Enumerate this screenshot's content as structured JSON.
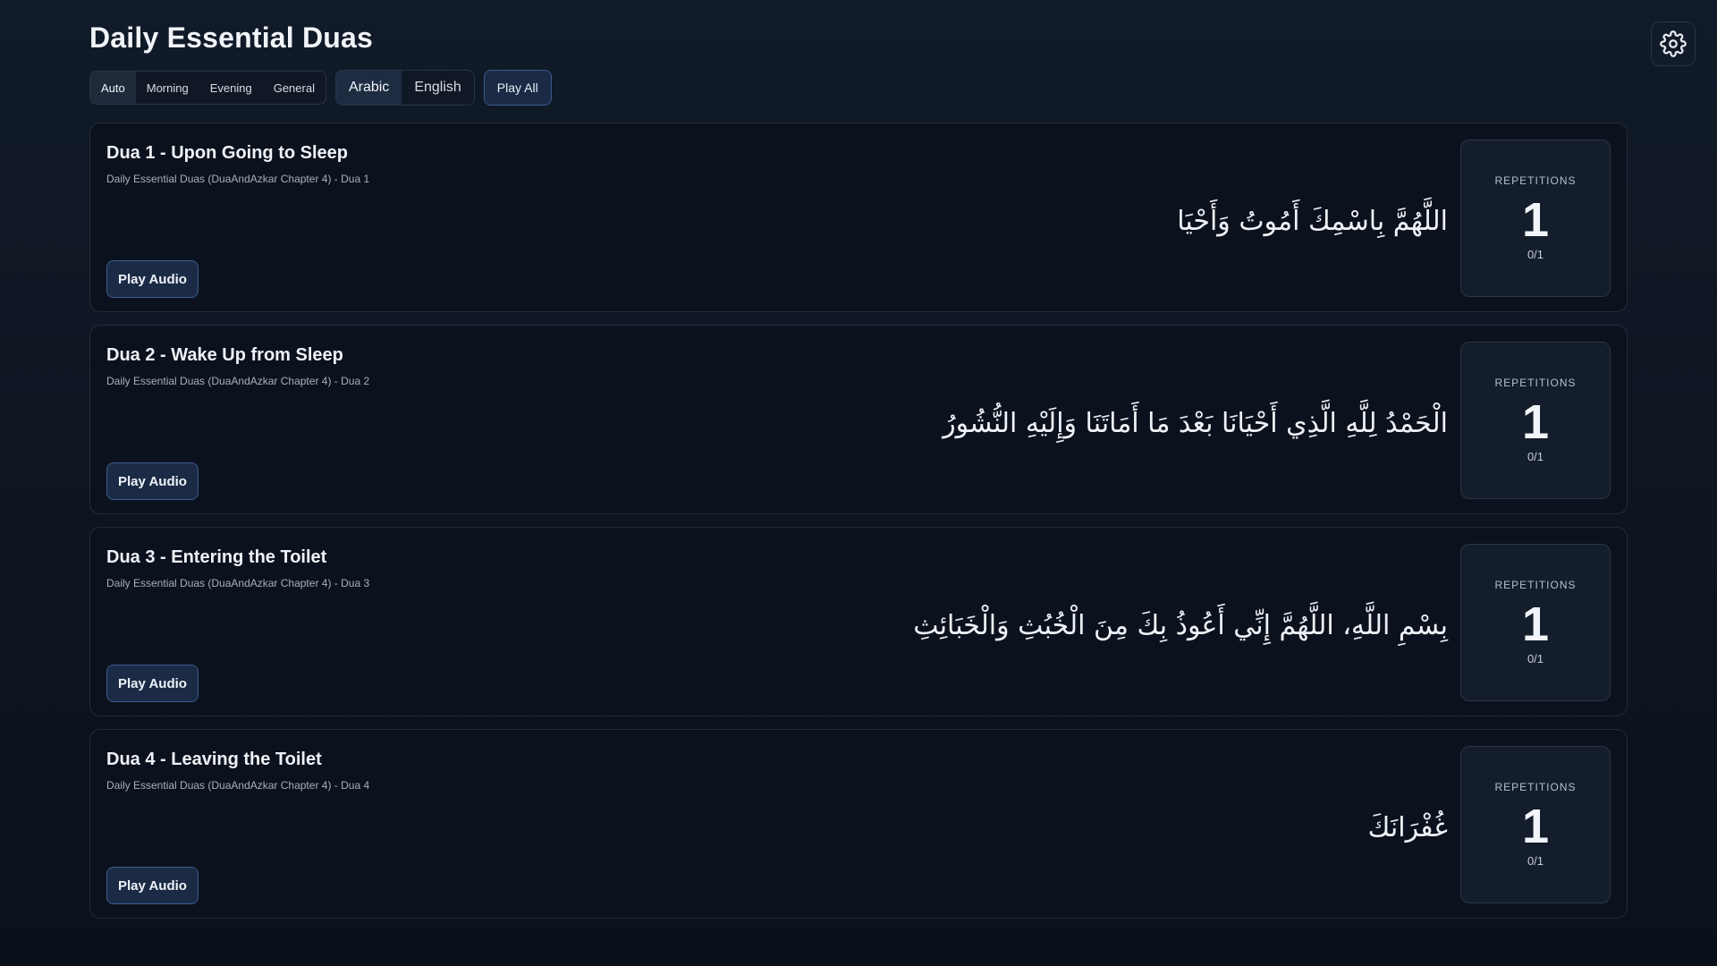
{
  "header": {
    "title": "Daily Essential Duas",
    "settings_icon": "gear-icon"
  },
  "controls": {
    "time_filters": [
      {
        "label": "Auto",
        "active": true
      },
      {
        "label": "Morning",
        "active": false
      },
      {
        "label": "Evening",
        "active": false
      },
      {
        "label": "General",
        "active": false
      }
    ],
    "languages": [
      {
        "label": "Arabic",
        "active": true
      },
      {
        "label": "English",
        "active": false
      }
    ],
    "play_all_label": "Play All"
  },
  "duas": [
    {
      "title": "Dua 1 - Upon Going to Sleep",
      "source": "Daily Essential Duas (DuaAndAzkar Chapter 4) - Dua 1",
      "arabic": "اللَّهُمَّ بِاسْمِكَ أَمُوتُ وَأَحْيَا",
      "play_label": "Play Audio",
      "repetitions_label": "REPETITIONS",
      "repetitions": "1",
      "progress": "0/1"
    },
    {
      "title": "Dua 2 - Wake Up from Sleep",
      "source": "Daily Essential Duas (DuaAndAzkar Chapter 4) - Dua 2",
      "arabic": "الْحَمْدُ لِلَّهِ الَّذِي أَحْيَانَا بَعْدَ مَا أَمَاتَنَا وَإِلَيْهِ النُّشُورُ",
      "play_label": "Play Audio",
      "repetitions_label": "REPETITIONS",
      "repetitions": "1",
      "progress": "0/1"
    },
    {
      "title": "Dua 3 - Entering the Toilet",
      "source": "Daily Essential Duas (DuaAndAzkar Chapter 4) - Dua 3",
      "arabic": "بِسْمِ اللَّهِ، اللَّهُمَّ إِنِّي أَعُوذُ بِكَ مِنَ الْخُبُثِ وَالْخَبَائِثِ",
      "play_label": "Play Audio",
      "repetitions_label": "REPETITIONS",
      "repetitions": "1",
      "progress": "0/1"
    },
    {
      "title": "Dua 4 - Leaving the Toilet",
      "source": "Daily Essential Duas (DuaAndAzkar Chapter 4) - Dua 4",
      "arabic": "غُفْرَانَكَ",
      "play_label": "Play Audio",
      "repetitions_label": "REPETITIONS",
      "repetitions": "1",
      "progress": "0/1"
    }
  ]
}
